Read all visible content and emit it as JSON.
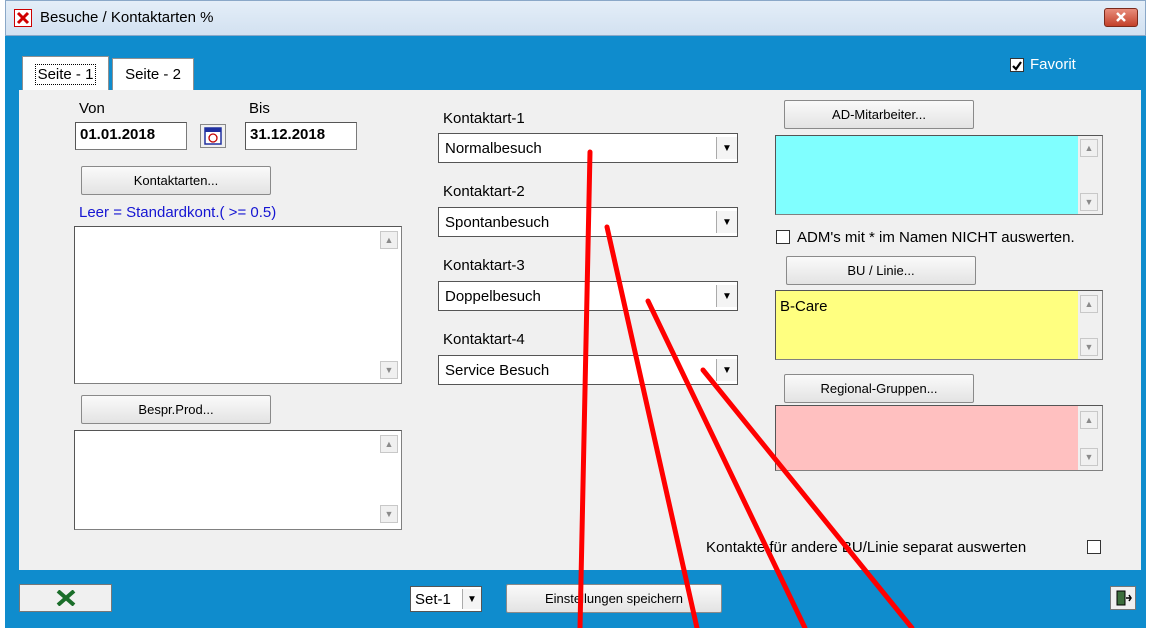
{
  "window": {
    "title": "Besuche / Kontaktarten %",
    "close_glyph": "✕"
  },
  "tabs": [
    {
      "label": "Seite - 1",
      "active": true
    },
    {
      "label": "Seite - 2",
      "active": false
    }
  ],
  "favorit": {
    "label": "Favorit",
    "checked": true
  },
  "dates": {
    "von_label": "Von",
    "von_value": "01.01.2018",
    "bis_label": "Bis",
    "bis_value": "31.12.2018"
  },
  "left": {
    "kontaktarten_button": "Kontaktarten...",
    "hint": "Leer = Standardkont.( >= 0.5)",
    "bespr_button": "Bespr.Prod..."
  },
  "kontaktarten": [
    {
      "label": "Kontaktart-1",
      "value": "Normalbesuch"
    },
    {
      "label": "Kontaktart-2",
      "value": "Spontanbesuch"
    },
    {
      "label": "Kontaktart-3",
      "value": "Doppelbesuch"
    },
    {
      "label": "Kontaktart-4",
      "value": "Service Besuch"
    }
  ],
  "right": {
    "ad_button": "AD-Mitarbeiter...",
    "adm_checkbox_label": "ADM's mit * im Namen NICHT auswerten.",
    "bu_button": "BU / Linie...",
    "bu_value": "B-Care",
    "regional_button": "Regional-Gruppen...",
    "separate_label": "Kontakte für andere BU/Linie separat auswerten",
    "colors": {
      "ad_list": "#80ffff",
      "bu_list": "#ffff80",
      "regional_list": "#ffc0c0"
    }
  },
  "footer": {
    "set_value": "Set-1",
    "save_button": "Einstellungen speichern"
  },
  "colors": {
    "window_blue": "#0f8ccd",
    "panel": "#f0f0f0",
    "annotation": "#ff0000",
    "hint": "#1515d2"
  }
}
